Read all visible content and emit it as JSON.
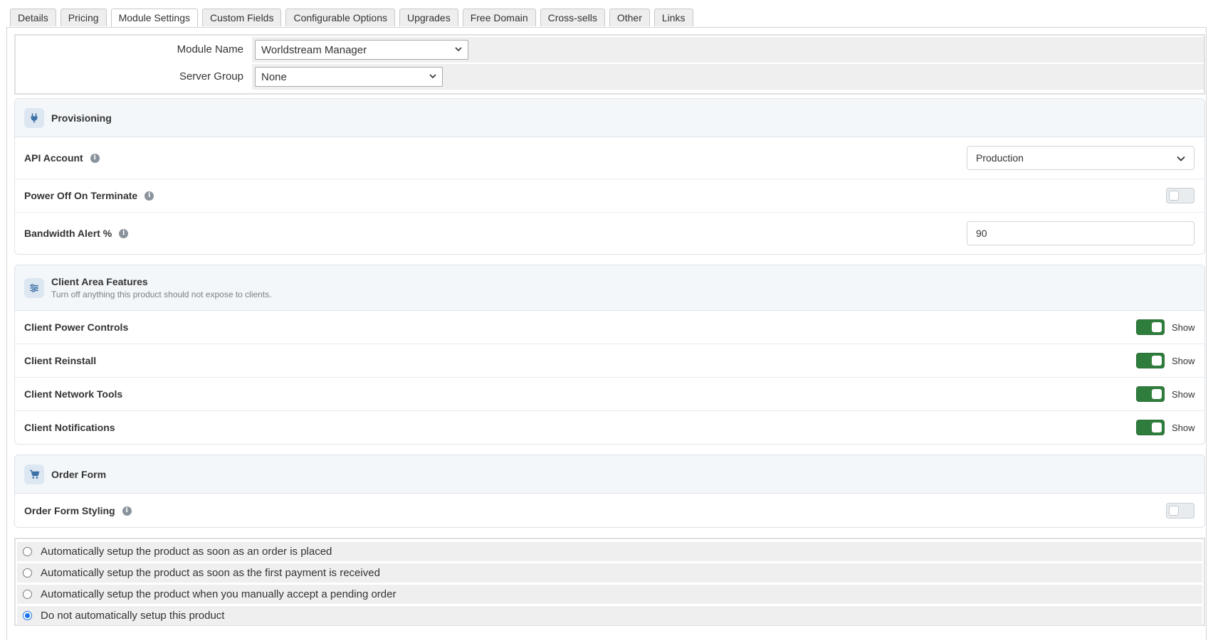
{
  "tabs": [
    {
      "label": "Details",
      "active": false
    },
    {
      "label": "Pricing",
      "active": false
    },
    {
      "label": "Module Settings",
      "active": true
    },
    {
      "label": "Custom Fields",
      "active": false
    },
    {
      "label": "Configurable Options",
      "active": false
    },
    {
      "label": "Upgrades",
      "active": false
    },
    {
      "label": "Free Domain",
      "active": false
    },
    {
      "label": "Cross-sells",
      "active": false
    },
    {
      "label": "Other",
      "active": false
    },
    {
      "label": "Links",
      "active": false
    }
  ],
  "module": {
    "module_name_label": "Module Name",
    "module_name_value": "Worldstream Manager",
    "server_group_label": "Server Group",
    "server_group_value": "None"
  },
  "provisioning": {
    "title": "Provisioning",
    "icon": "plug-icon",
    "api_account_label": "API Account",
    "api_account_value": "Production",
    "power_off_label": "Power Off On Terminate",
    "power_off_enabled": false,
    "bandwidth_label": "Bandwidth Alert %",
    "bandwidth_value": "90"
  },
  "client_area": {
    "title": "Client Area Features",
    "subtitle": "Turn off anything this product should not expose to clients.",
    "icon": "sliders-icon",
    "items": [
      {
        "label": "Client Power Controls",
        "state_text": "Show",
        "enabled": true
      },
      {
        "label": "Client Reinstall",
        "state_text": "Show",
        "enabled": true
      },
      {
        "label": "Client Network Tools",
        "state_text": "Show",
        "enabled": true
      },
      {
        "label": "Client Notifications",
        "state_text": "Show",
        "enabled": true
      }
    ]
  },
  "order_form": {
    "title": "Order Form",
    "icon": "cart-icon",
    "styling_label": "Order Form Styling",
    "styling_enabled": false
  },
  "setup_options": [
    {
      "label": "Automatically setup the product as soon as an order is placed",
      "checked": false
    },
    {
      "label": "Automatically setup the product as soon as the first payment is received",
      "checked": false
    },
    {
      "label": "Automatically setup the product when you manually accept a pending order",
      "checked": false
    },
    {
      "label": "Do not automatically setup this product",
      "checked": true
    }
  ],
  "colors": {
    "toggle_on": "#2f7d3c",
    "card_header_bg": "#f3f7fa",
    "icon_tint": "#3b6fa6",
    "radio_checked": "#1a73e8"
  }
}
